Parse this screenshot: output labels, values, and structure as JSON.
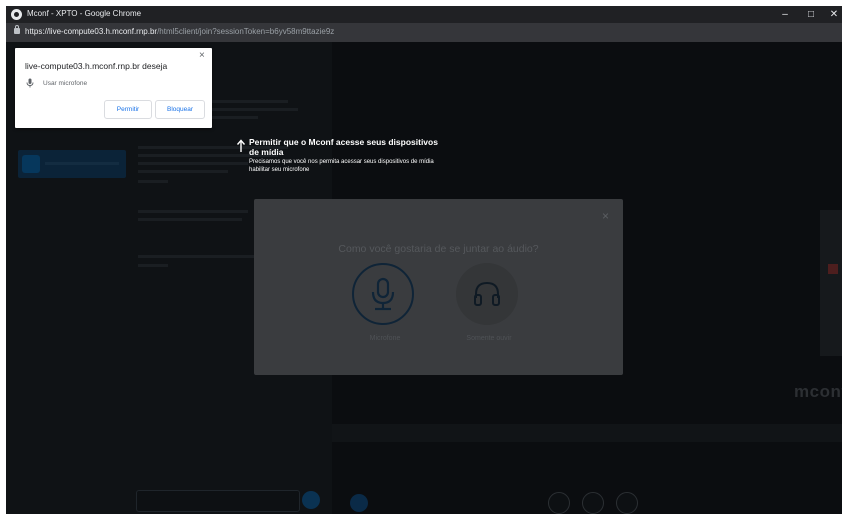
{
  "window": {
    "title": "Mconf - XPTO - Google Chrome",
    "minimize_icon": "–",
    "maximize_icon": "□",
    "close_icon": "✕"
  },
  "address_bar": {
    "host": "https://live-compute03.h.mconf.rnp.br",
    "path": "/html5client/join?sessionToken=b6yv58m9ttazie9z"
  },
  "permission_popup": {
    "title": "live-compute03.h.mconf.rnp.br deseja",
    "permission_label": "Usar microfone",
    "allow_label": "Permitir",
    "block_label": "Bloquear",
    "close_icon": "×"
  },
  "media_prompt": {
    "title": "Permitir que o Mconf acesse seus dispositivos de mídia",
    "subtitle": "Precisamos que você nos permita acessar seus dispositivos de mídia habilitar seu microfone"
  },
  "audio_modal": {
    "question": "Como você gostaria de se juntar ao áudio?",
    "close_icon": "×",
    "options": [
      {
        "label": "Microfone",
        "icon": "microphone-icon"
      },
      {
        "label": "Somente ouvir",
        "icon": "headphones-icon"
      }
    ]
  },
  "background": {
    "watermark": "mconf"
  },
  "colors": {
    "accent": "#1a73e8",
    "modal_bg": "#3a3c3f",
    "app_bg": "#0d1013"
  }
}
